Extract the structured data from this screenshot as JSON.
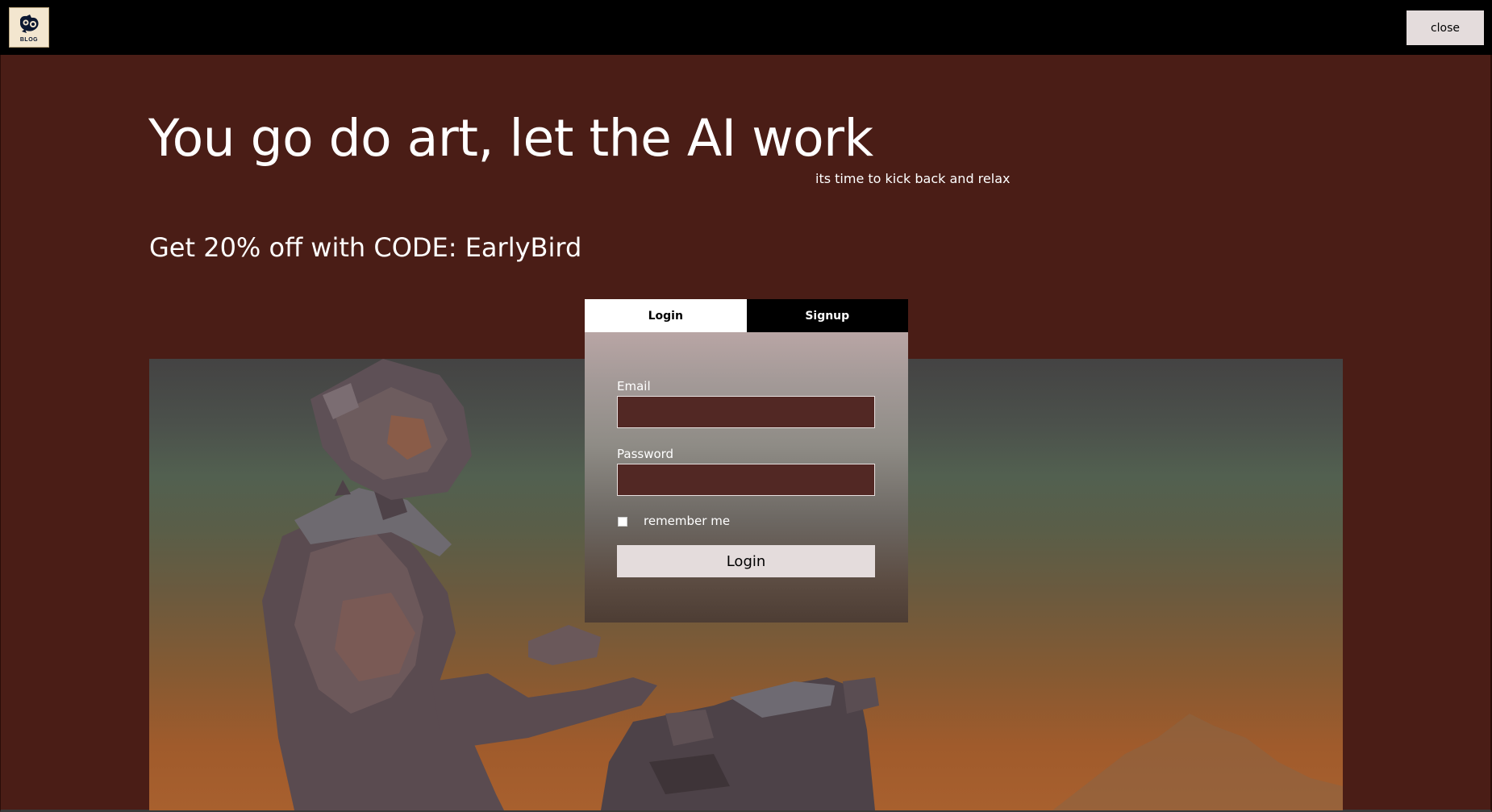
{
  "header": {
    "logo_text": "BLOG",
    "close_label": "close"
  },
  "hero": {
    "headline": "You go do art, let the AI work",
    "subheadline": "its time to kick back and relax",
    "promo": "Get 20% off with CODE: EarlyBird"
  },
  "auth": {
    "tabs": [
      {
        "label": "Login",
        "active": true
      },
      {
        "label": "Signup",
        "active": false
      }
    ],
    "email_label": "Email",
    "email_value": "",
    "password_label": "Password",
    "password_value": "",
    "remember_label": "remember me",
    "remember_checked": false,
    "submit_label": "Login"
  },
  "colors": {
    "page_bg": "#4a1d16",
    "topbar_bg": "#000000",
    "button_bg": "#e4dcdc",
    "input_bg": "#522824"
  }
}
